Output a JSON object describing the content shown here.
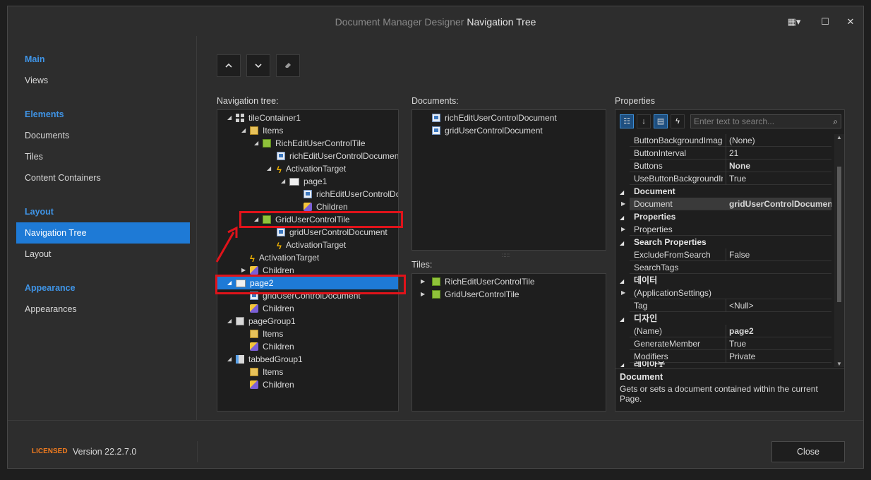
{
  "window": {
    "title_prefix": "Document Manager Designer",
    "title_main": "Navigation Tree"
  },
  "sidebar": {
    "groups": [
      {
        "title": "Main",
        "items": [
          "Views"
        ]
      },
      {
        "title": "Elements",
        "items": [
          "Documents",
          "Tiles",
          "Content Containers"
        ]
      },
      {
        "title": "Layout",
        "items": [
          "Navigation Tree",
          "Layout"
        ]
      },
      {
        "title": "Appearance",
        "items": [
          "Appearances"
        ]
      }
    ],
    "active_item": "Navigation Tree"
  },
  "toolbar": {
    "move_up_icon": "chevron-up-icon",
    "move_down_icon": "chevron-down-icon",
    "clear_icon": "eraser-icon"
  },
  "nav_tree": {
    "label": "Navigation tree:",
    "nodes": [
      {
        "text": "tileContainer1",
        "icon": "tile-container-icon",
        "expanded": true
      },
      {
        "text": "Items",
        "icon": "items-icon",
        "expanded": true
      },
      {
        "text": "RichEditUserControlTile",
        "icon": "tile-icon",
        "expanded": true
      },
      {
        "text": "richEditUserControlDocument",
        "icon": "document-icon"
      },
      {
        "text": "ActivationTarget",
        "icon": "lightning-icon",
        "expanded": true
      },
      {
        "text": "page1",
        "icon": "page-icon",
        "expanded": true
      },
      {
        "text": "richEditUserControlDocument",
        "icon": "document-icon"
      },
      {
        "text": "Children",
        "icon": "children-icon"
      },
      {
        "text": "GridUserControlTile",
        "icon": "tile-icon",
        "expanded": true
      },
      {
        "text": "gridUserControlDocument",
        "icon": "document-icon"
      },
      {
        "text": "ActivationTarget",
        "icon": "lightning-icon"
      },
      {
        "text": "ActivationTarget",
        "icon": "lightning-icon"
      },
      {
        "text": "Children",
        "icon": "children-icon",
        "expanded": false
      },
      {
        "text": "page2",
        "icon": "page-icon",
        "expanded": true,
        "selected": true
      },
      {
        "text": "gridUserControlDocument",
        "icon": "document-icon"
      },
      {
        "text": "Children",
        "icon": "children-icon"
      },
      {
        "text": "pageGroup1",
        "icon": "page-group-icon",
        "expanded": true
      },
      {
        "text": "Items",
        "icon": "items-icon"
      },
      {
        "text": "Children",
        "icon": "children-icon"
      },
      {
        "text": "tabbedGroup1",
        "icon": "tabbed-group-icon",
        "expanded": true
      },
      {
        "text": "Items",
        "icon": "items-icon"
      },
      {
        "text": "Children",
        "icon": "children-icon"
      }
    ]
  },
  "documents": {
    "label": "Documents:",
    "items": [
      "richEditUserControlDocument",
      "gridUserControlDocument"
    ]
  },
  "tiles": {
    "label": "Tiles:",
    "items": [
      "RichEditUserControlTile",
      "GridUserControlTile"
    ]
  },
  "properties": {
    "label": "Properties",
    "search_placeholder": "Enter text to search...",
    "rows": [
      {
        "type": "prop",
        "name": "ButtonBackgroundImage",
        "value": "(None)"
      },
      {
        "type": "prop",
        "name": "ButtonInterval",
        "value": "21"
      },
      {
        "type": "prop",
        "name": "Buttons",
        "value": "None",
        "bold": true
      },
      {
        "type": "prop",
        "name": "UseButtonBackgroundImages",
        "value": "True"
      },
      {
        "type": "cat",
        "name": "Document"
      },
      {
        "type": "prop",
        "name": "Document",
        "value": "gridUserControlDocument",
        "bold": true,
        "expandable": true,
        "highlight": true
      },
      {
        "type": "cat",
        "name": "Properties"
      },
      {
        "type": "prop",
        "name": "Properties",
        "value": "",
        "expandable": true
      },
      {
        "type": "cat",
        "name": "Search Properties"
      },
      {
        "type": "prop",
        "name": "ExcludeFromSearch",
        "value": "False"
      },
      {
        "type": "prop",
        "name": "SearchTags",
        "value": ""
      },
      {
        "type": "cat",
        "name": "데이터"
      },
      {
        "type": "prop",
        "name": "(ApplicationSettings)",
        "value": "",
        "expandable": true
      },
      {
        "type": "prop",
        "name": "Tag",
        "value": "<Null>"
      },
      {
        "type": "cat",
        "name": "디자인"
      },
      {
        "type": "prop",
        "name": "(Name)",
        "value": "page2",
        "bold": true
      },
      {
        "type": "prop",
        "name": "GenerateMember",
        "value": "True"
      },
      {
        "type": "prop",
        "name": "Modifiers",
        "value": "Private"
      },
      {
        "type": "cat",
        "name": "레이아웃"
      }
    ],
    "description_title": "Document",
    "description_text": "Gets or sets a document contained within the current Page."
  },
  "footer": {
    "license": "LICENSED",
    "version": "Version 22.2.7.0",
    "close_label": "Close"
  },
  "colors": {
    "accent": "#1e7ad6",
    "group_title": "#3f94e6",
    "highlight_box": "#e0131a",
    "license": "#f07b1f"
  }
}
